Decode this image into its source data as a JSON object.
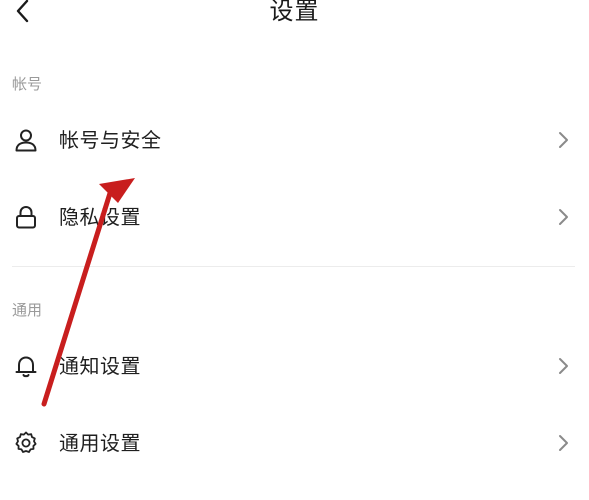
{
  "header": {
    "title": "设置",
    "back_icon": "chevron-left-icon"
  },
  "sections": {
    "account": {
      "label": "帐号",
      "items": [
        {
          "label": "帐号与安全",
          "icon": "user-icon"
        },
        {
          "label": "隐私设置",
          "icon": "lock-icon"
        }
      ]
    },
    "general": {
      "label": "通用",
      "items": [
        {
          "label": "通知设置",
          "icon": "bell-icon"
        },
        {
          "label": "通用设置",
          "icon": "gear-icon"
        }
      ]
    }
  },
  "annotation": {
    "color": "#c81e1e",
    "icon": "arrow-annotation"
  },
  "colors": {
    "section_label": "#9a9a9a",
    "text": "#1f1f1f",
    "chevron": "#8a8a8a"
  }
}
